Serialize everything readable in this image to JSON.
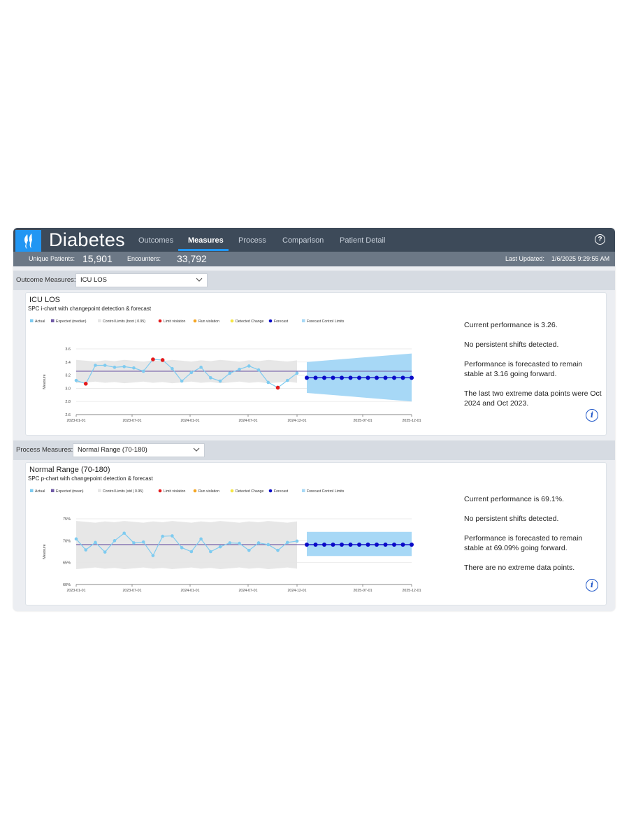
{
  "app": {
    "title": "Diabetes",
    "nav": [
      {
        "label": "Outcomes",
        "active": false
      },
      {
        "label": "Measures",
        "active": true
      },
      {
        "label": "Process",
        "active": false
      },
      {
        "label": "Comparison",
        "active": false
      },
      {
        "label": "Patient Detail",
        "active": false
      }
    ],
    "help_icon": "?",
    "colors": {
      "topbar": "#3d4a59",
      "statsbar": "#6c7886",
      "accent": "#2196f3",
      "info": "#1e56c8"
    }
  },
  "stats": {
    "unique_patients_label": "Unique Patients:",
    "unique_patients_value": "15,901",
    "encounters_label": "Encounters:",
    "encounters_value": "33,792",
    "last_updated_label": "Last Updated:",
    "last_updated_value": "1/6/2025 9:29:55 AM"
  },
  "outcome": {
    "section_label": "Outcome Measures:",
    "selected": "ICU LOS",
    "card": {
      "title": "ICU LOS",
      "subtitle": "SPC i-chart with changepoint detection & forecast",
      "legend": [
        "Actual",
        "Expected (median)",
        "Control Limits (boot | 0.95)",
        "Limit violation",
        "Run violation",
        "Detected Change",
        "Forecast",
        "Forecast Control Limits"
      ],
      "insights": [
        "Current performance is 3.26.",
        "No persistent shifts detected.",
        "Performance is forecasted to remain stable at 3.16 going forward.",
        "The last two extreme data points were Oct 2024 and Oct 2023."
      ]
    }
  },
  "process": {
    "section_label": "Process Measures:",
    "selected": "Normal Range (70-180)",
    "card": {
      "title": "Normal Range (70-180)",
      "subtitle": "SPC p-chart with changepoint detection & forecast",
      "legend": [
        "Actual",
        "Expected (mean)",
        "Control Limits (std | 0.95)",
        "Limit violation",
        "Run violation",
        "Detected Change",
        "Forecast",
        "Forecast Control Limits"
      ],
      "insights": [
        "Current performance is 69.1%.",
        "No persistent shifts detected.",
        "Performance is forecasted to remain stable at 69.09% going forward.",
        "There are no extreme data points."
      ]
    }
  },
  "chart_data": [
    {
      "type": "line",
      "ylabel": "Measure",
      "ylim": [
        2.6,
        3.6
      ],
      "yticks": [
        "2.6",
        "2.8",
        "3.0",
        "3.2",
        "3.4",
        "3.6"
      ],
      "xticks": [
        "2023-01-01",
        "2023-07-01",
        "2024-01-01",
        "2024-07-01",
        "2024-12-01",
        "2025-07-01",
        "2025-12-01"
      ],
      "grid": true,
      "legend_position": "top-left",
      "expected": 3.26,
      "control_limits": [
        3.09,
        3.42
      ],
      "forecast_value": 3.16,
      "actual": [
        3.12,
        3.07,
        3.35,
        3.35,
        3.32,
        3.33,
        3.31,
        3.26,
        3.44,
        3.43,
        3.3,
        3.11,
        3.24,
        3.32,
        3.16,
        3.11,
        3.23,
        3.29,
        3.34,
        3.28,
        3.09,
        3.01,
        3.12,
        3.23
      ],
      "limit_violation_indices": [
        1,
        8,
        9,
        21
      ],
      "forecast_count": 13,
      "forecast_limits_start": [
        2.93,
        3.4
      ],
      "forecast_limits_end": [
        2.8,
        3.53
      ],
      "colors": {
        "actual": "#7ecbf0",
        "expected": "#6f5aa6",
        "limits": "#e6e6e6",
        "violation": "#e41a1c",
        "forecast": "#0a0ac8",
        "forecast_limits": "#a7d8f6"
      }
    },
    {
      "type": "line",
      "ylabel": "Measure",
      "ylim": [
        60,
        75
      ],
      "yticks": [
        "60%",
        "65%",
        "70%",
        "75%"
      ],
      "xticks": [
        "2023-01-01",
        "2023-07-01",
        "2024-01-01",
        "2024-07-01",
        "2024-12-01",
        "2025-07-01",
        "2025-12-01"
      ],
      "grid": true,
      "legend_position": "top-left",
      "expected": 69.1,
      "control_limits": [
        63.7,
        74.3
      ],
      "forecast_value": 69.09,
      "actual": [
        70.4,
        67.9,
        69.6,
        67.4,
        70.0,
        71.7,
        69.5,
        69.7,
        66.6,
        71.0,
        71.1,
        68.4,
        67.5,
        70.4,
        67.5,
        68.6,
        69.5,
        69.4,
        67.8,
        69.5,
        69.1,
        67.8,
        69.6,
        69.9
      ],
      "limit_violation_indices": [],
      "forecast_count": 13,
      "forecast_limits_start": [
        66.5,
        72.0
      ],
      "forecast_limits_end": [
        66.5,
        72.0
      ],
      "colors": {
        "actual": "#7ecbf0",
        "expected": "#6f5aa6",
        "limits": "#e6e6e6",
        "violation": "#e41a1c",
        "forecast": "#0a0ac8",
        "forecast_limits": "#a7d8f6"
      }
    }
  ]
}
